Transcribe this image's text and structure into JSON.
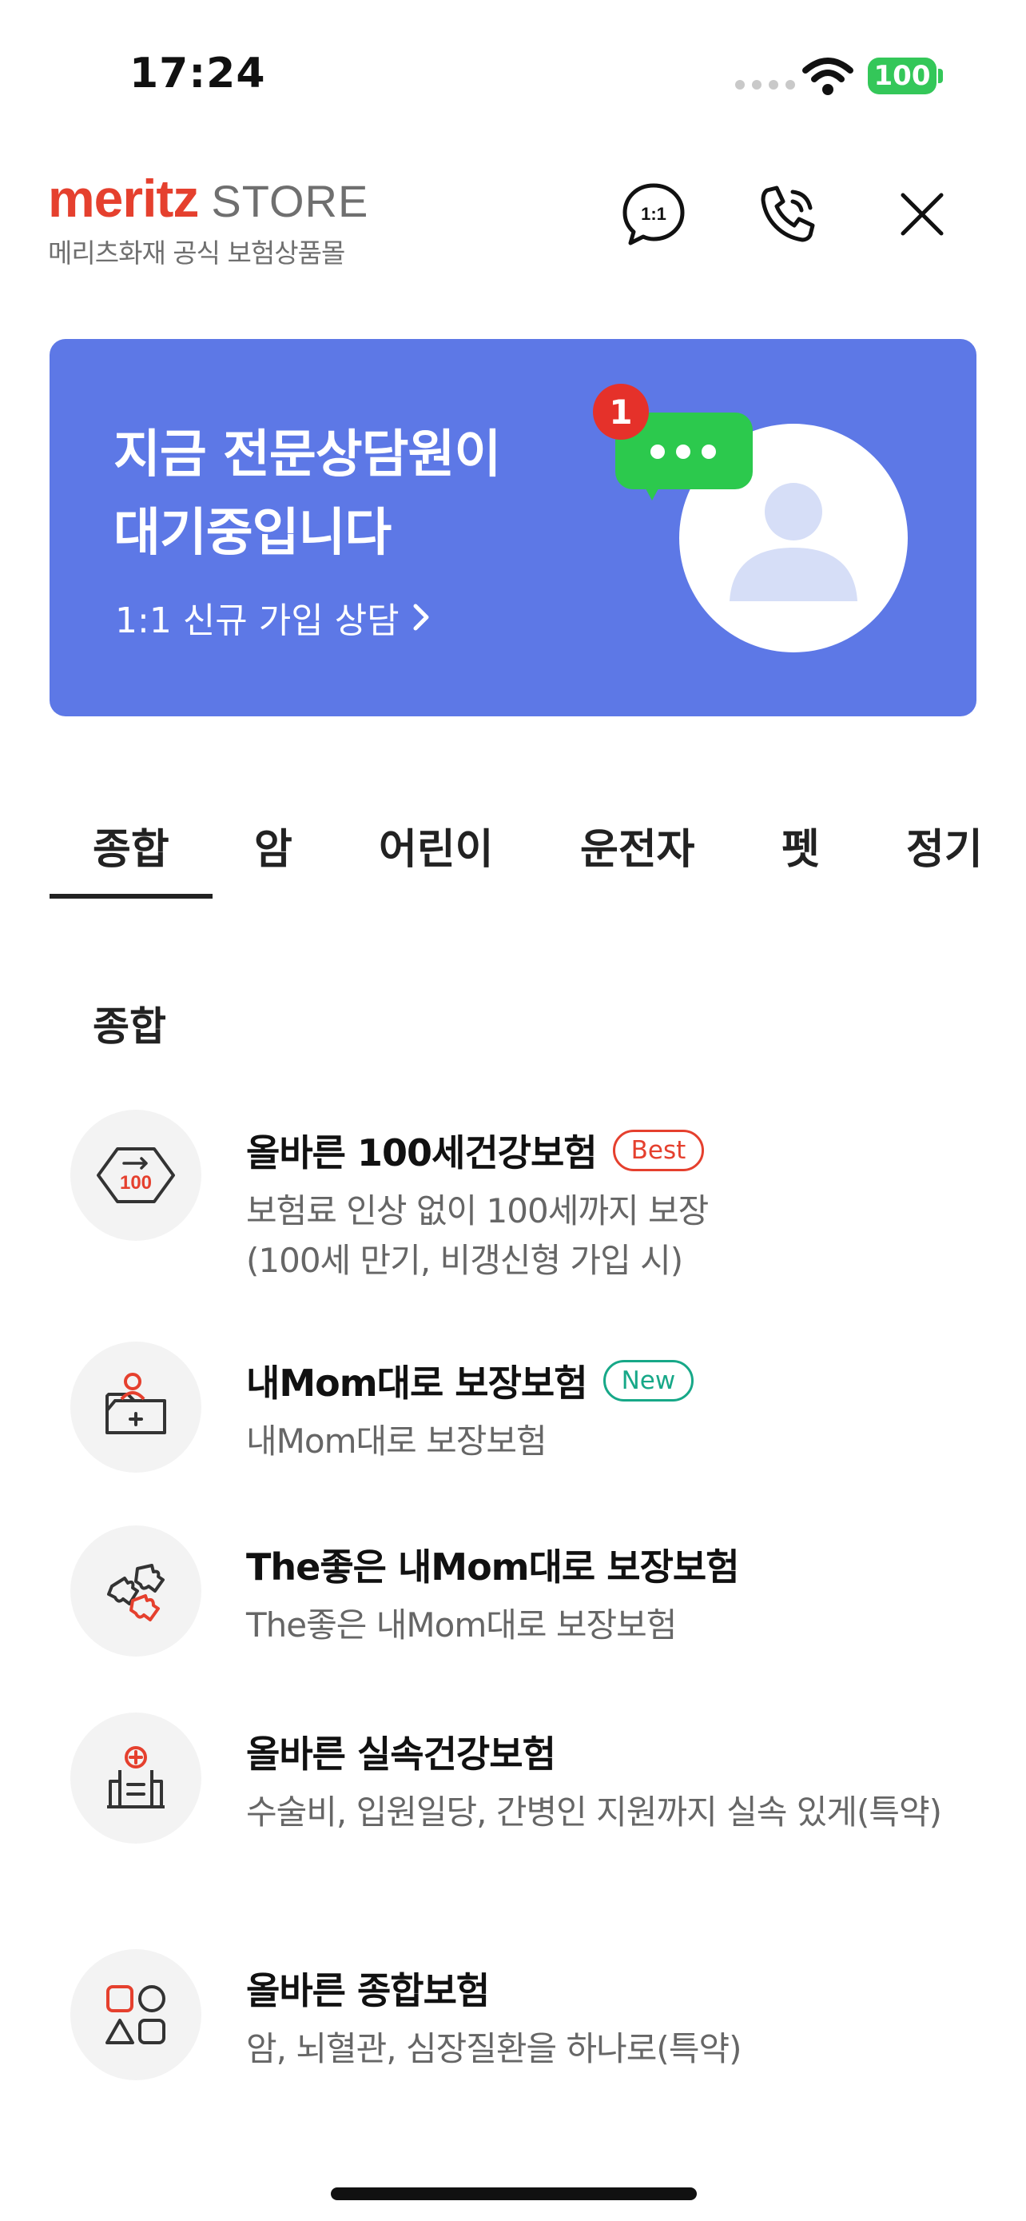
{
  "status_bar": {
    "time": "17:24",
    "battery": "100"
  },
  "header": {
    "logo_brand": "meritz",
    "logo_store": "STORE",
    "logo_subtitle": "메리츠화재 공식 보험상품몰",
    "chat_icon_label": "1:1"
  },
  "banner": {
    "title_line1": "지금 전문상담원이",
    "title_line2": "대기중입니다",
    "link_label": "1:1 신규 가입 상담",
    "notification_count": "1",
    "background_color": "#5d78e6"
  },
  "tabs": [
    {
      "label": "종합",
      "active": true
    },
    {
      "label": "암",
      "active": false
    },
    {
      "label": "어린이",
      "active": false
    },
    {
      "label": "운전자",
      "active": false
    },
    {
      "label": "펫",
      "active": false
    },
    {
      "label": "정기",
      "active": false
    }
  ],
  "section": {
    "title": "종합"
  },
  "products": [
    {
      "name": "올바른 100세건강보험",
      "badge": "Best",
      "desc": "보험료 인상 없이 100세까지 보장\n(100세 만기, 비갱신형 가입 시)",
      "icon": "100-tag-icon",
      "icon_text": "100"
    },
    {
      "name": "내Mom대로 보장보험",
      "badge": "New",
      "desc": "내Mom대로 보장보험",
      "icon": "folder-person-icon"
    },
    {
      "name": "The좋은 내Mom대로 보장보험",
      "badge": "",
      "desc": "The좋은 내Mom대로 보장보험",
      "icon": "puzzle-icon"
    },
    {
      "name": "올바른 실속건강보험",
      "badge": "",
      "desc": "수술비, 입원일당, 간병인 지원까지 실속 있게(특약)",
      "icon": "hospital-icon"
    },
    {
      "name": "올바른 종합보험",
      "badge": "",
      "desc": "암, 뇌혈관, 심장질환을 하나로(특약)",
      "icon": "shapes-icon"
    }
  ],
  "colors": {
    "brand_red": "#e5402e",
    "best_badge": "#e5402e",
    "new_badge": "#17a888",
    "chat_green": "#2cc94d",
    "battery_green": "#34c759"
  }
}
